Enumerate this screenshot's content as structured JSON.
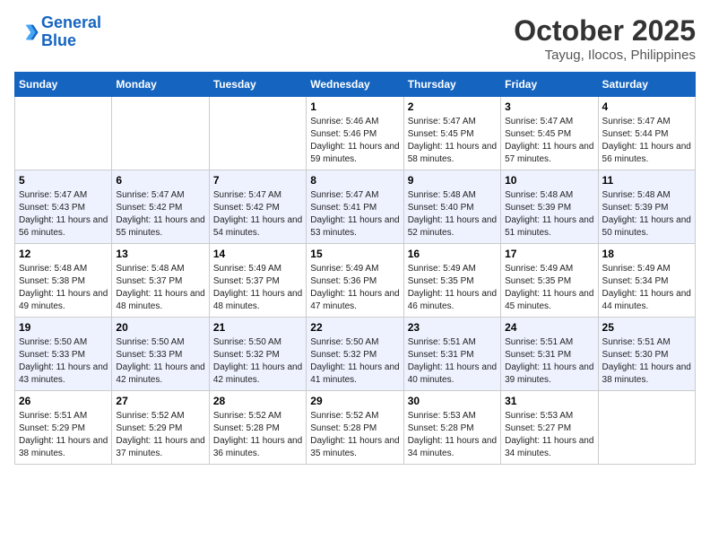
{
  "header": {
    "logo_line1": "General",
    "logo_line2": "Blue",
    "month": "October 2025",
    "location": "Tayug, Ilocos, Philippines"
  },
  "weekdays": [
    "Sunday",
    "Monday",
    "Tuesday",
    "Wednesday",
    "Thursday",
    "Friday",
    "Saturday"
  ],
  "weeks": [
    [
      {
        "day": "",
        "sunrise": "",
        "sunset": "",
        "daylight": ""
      },
      {
        "day": "",
        "sunrise": "",
        "sunset": "",
        "daylight": ""
      },
      {
        "day": "",
        "sunrise": "",
        "sunset": "",
        "daylight": ""
      },
      {
        "day": "1",
        "sunrise": "Sunrise: 5:46 AM",
        "sunset": "Sunset: 5:46 PM",
        "daylight": "Daylight: 11 hours and 59 minutes."
      },
      {
        "day": "2",
        "sunrise": "Sunrise: 5:47 AM",
        "sunset": "Sunset: 5:45 PM",
        "daylight": "Daylight: 11 hours and 58 minutes."
      },
      {
        "day": "3",
        "sunrise": "Sunrise: 5:47 AM",
        "sunset": "Sunset: 5:45 PM",
        "daylight": "Daylight: 11 hours and 57 minutes."
      },
      {
        "day": "4",
        "sunrise": "Sunrise: 5:47 AM",
        "sunset": "Sunset: 5:44 PM",
        "daylight": "Daylight: 11 hours and 56 minutes."
      }
    ],
    [
      {
        "day": "5",
        "sunrise": "Sunrise: 5:47 AM",
        "sunset": "Sunset: 5:43 PM",
        "daylight": "Daylight: 11 hours and 56 minutes."
      },
      {
        "day": "6",
        "sunrise": "Sunrise: 5:47 AM",
        "sunset": "Sunset: 5:42 PM",
        "daylight": "Daylight: 11 hours and 55 minutes."
      },
      {
        "day": "7",
        "sunrise": "Sunrise: 5:47 AM",
        "sunset": "Sunset: 5:42 PM",
        "daylight": "Daylight: 11 hours and 54 minutes."
      },
      {
        "day": "8",
        "sunrise": "Sunrise: 5:47 AM",
        "sunset": "Sunset: 5:41 PM",
        "daylight": "Daylight: 11 hours and 53 minutes."
      },
      {
        "day": "9",
        "sunrise": "Sunrise: 5:48 AM",
        "sunset": "Sunset: 5:40 PM",
        "daylight": "Daylight: 11 hours and 52 minutes."
      },
      {
        "day": "10",
        "sunrise": "Sunrise: 5:48 AM",
        "sunset": "Sunset: 5:39 PM",
        "daylight": "Daylight: 11 hours and 51 minutes."
      },
      {
        "day": "11",
        "sunrise": "Sunrise: 5:48 AM",
        "sunset": "Sunset: 5:39 PM",
        "daylight": "Daylight: 11 hours and 50 minutes."
      }
    ],
    [
      {
        "day": "12",
        "sunrise": "Sunrise: 5:48 AM",
        "sunset": "Sunset: 5:38 PM",
        "daylight": "Daylight: 11 hours and 49 minutes."
      },
      {
        "day": "13",
        "sunrise": "Sunrise: 5:48 AM",
        "sunset": "Sunset: 5:37 PM",
        "daylight": "Daylight: 11 hours and 48 minutes."
      },
      {
        "day": "14",
        "sunrise": "Sunrise: 5:49 AM",
        "sunset": "Sunset: 5:37 PM",
        "daylight": "Daylight: 11 hours and 48 minutes."
      },
      {
        "day": "15",
        "sunrise": "Sunrise: 5:49 AM",
        "sunset": "Sunset: 5:36 PM",
        "daylight": "Daylight: 11 hours and 47 minutes."
      },
      {
        "day": "16",
        "sunrise": "Sunrise: 5:49 AM",
        "sunset": "Sunset: 5:35 PM",
        "daylight": "Daylight: 11 hours and 46 minutes."
      },
      {
        "day": "17",
        "sunrise": "Sunrise: 5:49 AM",
        "sunset": "Sunset: 5:35 PM",
        "daylight": "Daylight: 11 hours and 45 minutes."
      },
      {
        "day": "18",
        "sunrise": "Sunrise: 5:49 AM",
        "sunset": "Sunset: 5:34 PM",
        "daylight": "Daylight: 11 hours and 44 minutes."
      }
    ],
    [
      {
        "day": "19",
        "sunrise": "Sunrise: 5:50 AM",
        "sunset": "Sunset: 5:33 PM",
        "daylight": "Daylight: 11 hours and 43 minutes."
      },
      {
        "day": "20",
        "sunrise": "Sunrise: 5:50 AM",
        "sunset": "Sunset: 5:33 PM",
        "daylight": "Daylight: 11 hours and 42 minutes."
      },
      {
        "day": "21",
        "sunrise": "Sunrise: 5:50 AM",
        "sunset": "Sunset: 5:32 PM",
        "daylight": "Daylight: 11 hours and 42 minutes."
      },
      {
        "day": "22",
        "sunrise": "Sunrise: 5:50 AM",
        "sunset": "Sunset: 5:32 PM",
        "daylight": "Daylight: 11 hours and 41 minutes."
      },
      {
        "day": "23",
        "sunrise": "Sunrise: 5:51 AM",
        "sunset": "Sunset: 5:31 PM",
        "daylight": "Daylight: 11 hours and 40 minutes."
      },
      {
        "day": "24",
        "sunrise": "Sunrise: 5:51 AM",
        "sunset": "Sunset: 5:31 PM",
        "daylight": "Daylight: 11 hours and 39 minutes."
      },
      {
        "day": "25",
        "sunrise": "Sunrise: 5:51 AM",
        "sunset": "Sunset: 5:30 PM",
        "daylight": "Daylight: 11 hours and 38 minutes."
      }
    ],
    [
      {
        "day": "26",
        "sunrise": "Sunrise: 5:51 AM",
        "sunset": "Sunset: 5:29 PM",
        "daylight": "Daylight: 11 hours and 38 minutes."
      },
      {
        "day": "27",
        "sunrise": "Sunrise: 5:52 AM",
        "sunset": "Sunset: 5:29 PM",
        "daylight": "Daylight: 11 hours and 37 minutes."
      },
      {
        "day": "28",
        "sunrise": "Sunrise: 5:52 AM",
        "sunset": "Sunset: 5:28 PM",
        "daylight": "Daylight: 11 hours and 36 minutes."
      },
      {
        "day": "29",
        "sunrise": "Sunrise: 5:52 AM",
        "sunset": "Sunset: 5:28 PM",
        "daylight": "Daylight: 11 hours and 35 minutes."
      },
      {
        "day": "30",
        "sunrise": "Sunrise: 5:53 AM",
        "sunset": "Sunset: 5:28 PM",
        "daylight": "Daylight: 11 hours and 34 minutes."
      },
      {
        "day": "31",
        "sunrise": "Sunrise: 5:53 AM",
        "sunset": "Sunset: 5:27 PM",
        "daylight": "Daylight: 11 hours and 34 minutes."
      },
      {
        "day": "",
        "sunrise": "",
        "sunset": "",
        "daylight": ""
      }
    ]
  ]
}
